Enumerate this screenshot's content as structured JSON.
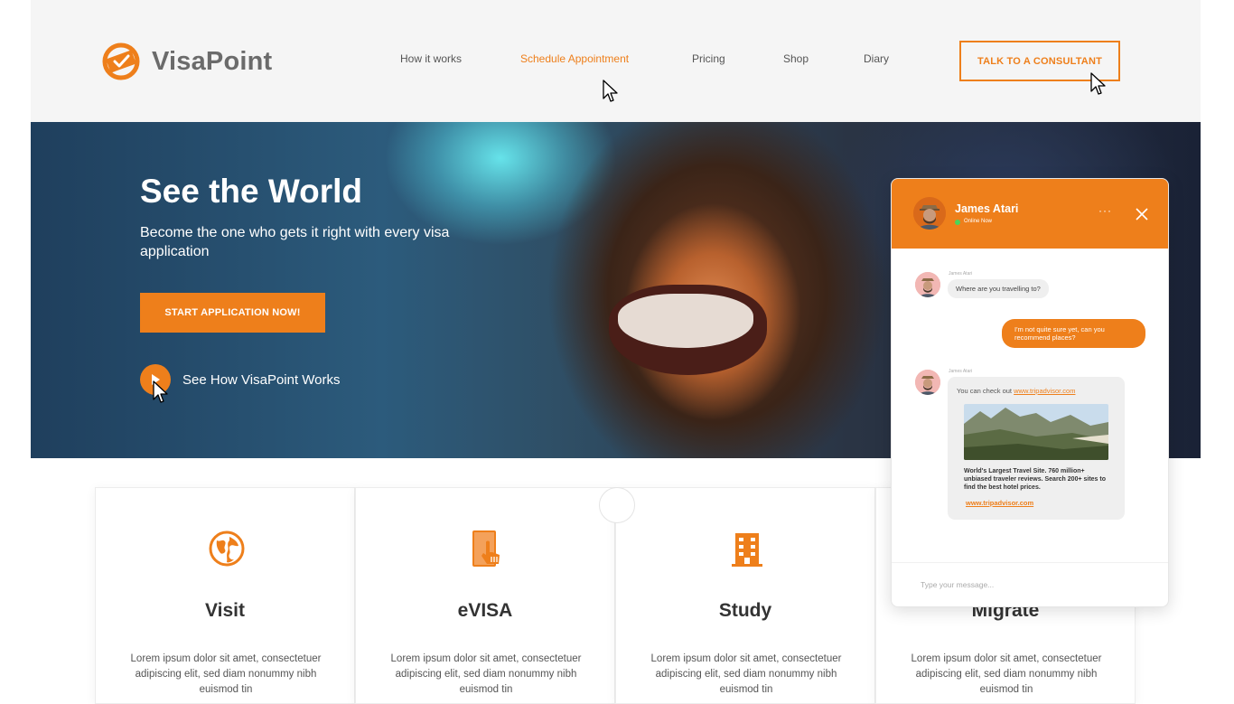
{
  "brand": {
    "name": "VisaPoint",
    "accent": "#ee7f1b"
  },
  "nav": {
    "items": [
      {
        "label": "How it works"
      },
      {
        "label": "Schedule Appointment",
        "active": true
      },
      {
        "label": "Pricing"
      },
      {
        "label": "Shop"
      },
      {
        "label": "Diary"
      }
    ],
    "cta_label": "TALK TO A CONSULTANT"
  },
  "hero": {
    "title": "See the World",
    "subtitle": "Become the one who gets it right with every visa application",
    "button_label": "START APPLICATION NOW!",
    "video_label": "See How VisaPoint Works"
  },
  "cards": [
    {
      "icon": "globe-icon",
      "title": "Visit",
      "text": "Lorem ipsum dolor sit amet, consectetuer adipiscing elit, sed diam nonummy nibh euismod tin"
    },
    {
      "icon": "phone-tap-icon",
      "title": "eVISA",
      "text": "Lorem ipsum dolor sit amet, consectetuer adipiscing elit, sed diam nonummy nibh euismod tin"
    },
    {
      "icon": "building-icon",
      "title": "Study",
      "text": "Lorem ipsum dolor sit amet, consectetuer adipiscing elit, sed diam nonummy nibh euismod tin"
    },
    {
      "icon": "migrate-icon",
      "title": "Migrate",
      "text": "Lorem ipsum dolor sit amet, consectetuer adipiscing elit, sed diam nonummy nibh euismod tin"
    }
  ],
  "chat": {
    "agent_name": "James Atari",
    "status": "Online Now",
    "more_label": "···",
    "messages": [
      {
        "sender": "James Atari",
        "text": "Where are you travelling to?"
      },
      {
        "sender": "me",
        "text": "I'm not quite sure yet, can you recommend places?"
      },
      {
        "sender": "James Atari",
        "text_prefix": "You can check out ",
        "link": "www.tripadvisor.com"
      }
    ],
    "link_preview": {
      "description": "World's Largest Travel Site. 760 million+ unbiased traveler reviews. Search 200+ sites to find the best hotel prices.",
      "url": "www.tripadvisor.com"
    },
    "input_placeholder": "Type your message..."
  }
}
